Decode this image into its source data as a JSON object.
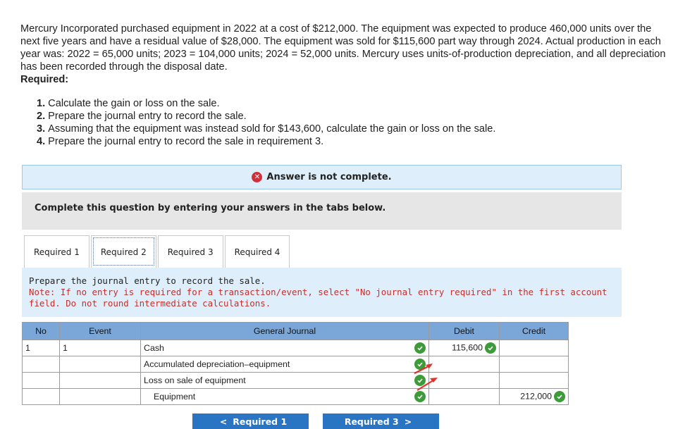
{
  "problem": {
    "text": "Mercury Incorporated purchased equipment in 2022 at a cost of $212,000. The equipment was expected to produce 460,000 units over the next five years and have a residual value of $28,000. The equipment was sold for $115,600 part way through 2024. Actual production in each year was: 2022 = 65,000 units; 2023 = 104,000 units; 2024 = 52,000 units. Mercury uses units-of-production depreciation, and all depreciation has been recorded through the disposal date.",
    "required_heading": "Required:",
    "requirements": [
      {
        "num": "1.",
        "text": "Calculate the gain or loss on the sale."
      },
      {
        "num": "2.",
        "text": "Prepare the journal entry to record the sale."
      },
      {
        "num": "3.",
        "text": "Assuming that the equipment was instead sold for $143,600, calculate the gain or loss on the sale."
      },
      {
        "num": "4.",
        "text": "Prepare the journal entry to record the sale in requirement 3."
      }
    ]
  },
  "alert": {
    "icon": "x-circle-icon",
    "text": "Answer is not complete.",
    "color": "#d32f3a"
  },
  "complete_prompt": "Complete this question by entering your answers in the tabs below.",
  "tabs": [
    {
      "label": "Required 1",
      "active": false
    },
    {
      "label": "Required 2",
      "active": true
    },
    {
      "label": "Required 3",
      "active": false
    },
    {
      "label": "Required 4",
      "active": false
    }
  ],
  "instruction": {
    "text": "Prepare the journal entry to record the sale.",
    "note": "Note: If no entry is required for a transaction/event, select \"No journal entry required\" in the first account field. Do not round intermediate calculations."
  },
  "journal": {
    "headers": {
      "no": "No",
      "event": "Event",
      "general_journal": "General Journal",
      "debit": "Debit",
      "credit": "Credit"
    },
    "rows": [
      {
        "no": "1",
        "event": "1",
        "account": "Cash",
        "debit": "115,600",
        "credit": ""
      },
      {
        "no": "",
        "event": "",
        "account": "Accumulated depreciation–equipment",
        "debit": "",
        "credit": ""
      },
      {
        "no": "",
        "event": "",
        "account": "Loss on sale of equipment",
        "debit": "",
        "credit": ""
      },
      {
        "no": "",
        "event": "",
        "account": "Equipment",
        "debit": "",
        "credit": "212,000"
      }
    ]
  },
  "nav": {
    "prev_label": "Required 1",
    "next_label": "Required 3"
  },
  "colors": {
    "check": "#3e9b3a",
    "nav_button": "#2a74c4",
    "header": "#7ba7d8",
    "arrow": "#e0312a"
  }
}
